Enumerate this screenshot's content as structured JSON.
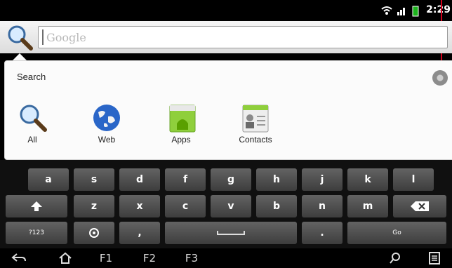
{
  "status": {
    "time": "2:29"
  },
  "search": {
    "placeholder": "Google"
  },
  "panel": {
    "title": "Search",
    "sources": [
      {
        "label": "All",
        "icon": "magnifier-icon"
      },
      {
        "label": "Web",
        "icon": "globe-icon"
      },
      {
        "label": "Apps",
        "icon": "android-apps-icon"
      },
      {
        "label": "Contacts",
        "icon": "contacts-icon"
      }
    ]
  },
  "keyboard": {
    "row1": [
      "a",
      "s",
      "d",
      "f",
      "g",
      "h",
      "j",
      "k",
      "l"
    ],
    "row2": [
      "z",
      "x",
      "c",
      "v",
      "b",
      "n",
      "m"
    ],
    "row3": {
      "sym": "?123",
      "comma": ",",
      "period": ".",
      "go": "Go"
    }
  },
  "navbar": {
    "f1": "F1",
    "f2": "F2",
    "f3": "F3"
  },
  "colors": {
    "accent_red": "#d4001b",
    "keyboard_bg": "#101010",
    "key_face": "#4f4f4f"
  }
}
